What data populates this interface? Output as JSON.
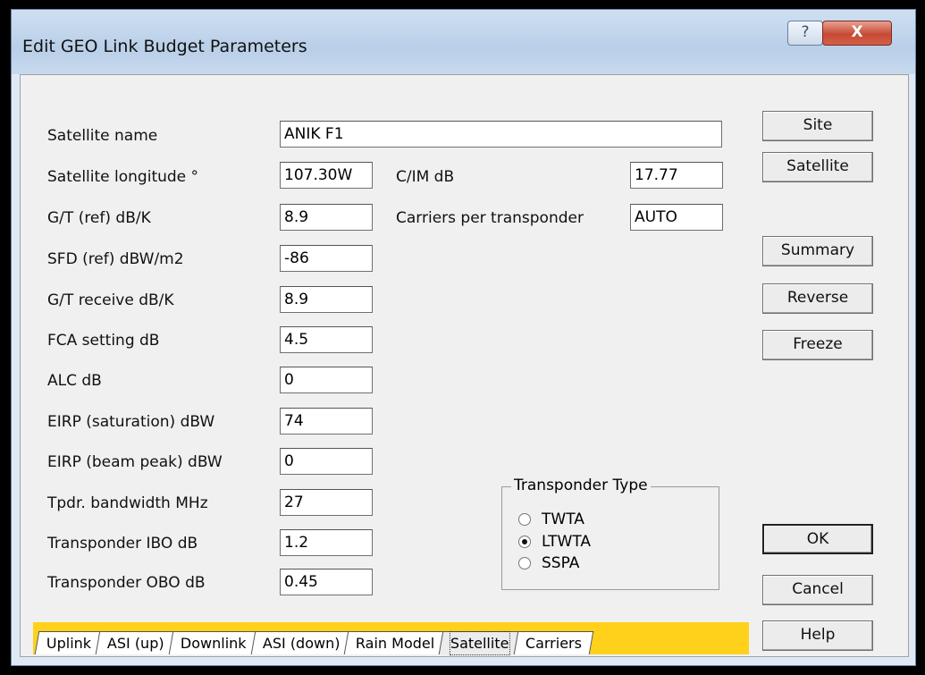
{
  "window": {
    "title": "Edit GEO Link Budget Parameters",
    "help_glyph": "?",
    "close_glyph": "X"
  },
  "fields": {
    "satellite_name": {
      "label": "Satellite name",
      "value": "ANIK F1"
    },
    "satellite_longitude": {
      "label": "Satellite longitude °",
      "value": "107.30W"
    },
    "gt_ref": {
      "label": "G/T (ref) dB/K",
      "value": "8.9"
    },
    "sfd_ref": {
      "label": "SFD (ref) dBW/m2",
      "value": "-86"
    },
    "gt_receive": {
      "label": "G/T receive dB/K",
      "value": "8.9"
    },
    "fca_setting": {
      "label": "FCA setting dB",
      "value": "4.5"
    },
    "alc": {
      "label": "ALC dB",
      "value": "0"
    },
    "eirp_saturation": {
      "label": "EIRP (saturation) dBW",
      "value": "74"
    },
    "eirp_beam_peak": {
      "label": "EIRP (beam peak) dBW",
      "value": "0"
    },
    "tpdr_bandwidth": {
      "label": "Tpdr. bandwidth MHz",
      "value": "27"
    },
    "transponder_ibo": {
      "label": "Transponder IBO dB",
      "value": "1.2"
    },
    "transponder_obo": {
      "label": "Transponder OBO dB",
      "value": "0.45"
    },
    "cim": {
      "label": "C/IM dB",
      "value": "17.77"
    },
    "carriers_per_transponder": {
      "label": "Carriers per transponder",
      "value": "AUTO"
    }
  },
  "buttons": {
    "site": "Site",
    "satellite": "Satellite",
    "summary": "Summary",
    "reverse": "Reverse",
    "freeze": "Freeze",
    "ok": "OK",
    "cancel": "Cancel",
    "help": "Help"
  },
  "transponder_type": {
    "title": "Transponder Type",
    "options": [
      "TWTA",
      "LTWTA",
      "SSPA"
    ],
    "selected": "LTWTA"
  },
  "tabs": [
    "Uplink",
    "ASI (up)",
    "Downlink",
    "ASI (down)",
    "Rain Model",
    "Satellite",
    "Carriers"
  ],
  "active_tab": "Satellite"
}
